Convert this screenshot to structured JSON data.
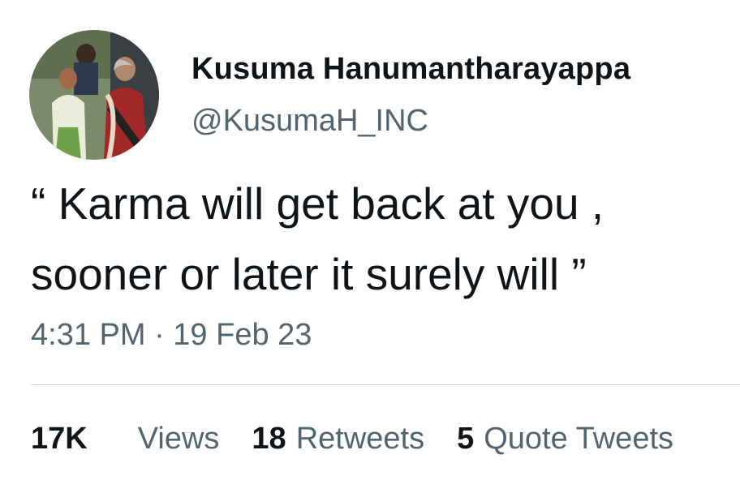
{
  "author": {
    "display_name": "Kusuma Hanumantharayappa",
    "handle": "@KusumaH_INC"
  },
  "tweet": {
    "text": "“ Karma will get back at you ,\nsooner or later it surely will ”",
    "timestamp": "4:31 PM · 19 Feb 23"
  },
  "stats": [
    {
      "count": "17K",
      "label": "Views"
    },
    {
      "count": "18",
      "label": "Retweets"
    },
    {
      "count": "5",
      "label": "Quote Tweets"
    }
  ],
  "colors": {
    "text_primary": "#0f1419",
    "text_secondary": "#536471",
    "divider": "#cfd9de"
  }
}
